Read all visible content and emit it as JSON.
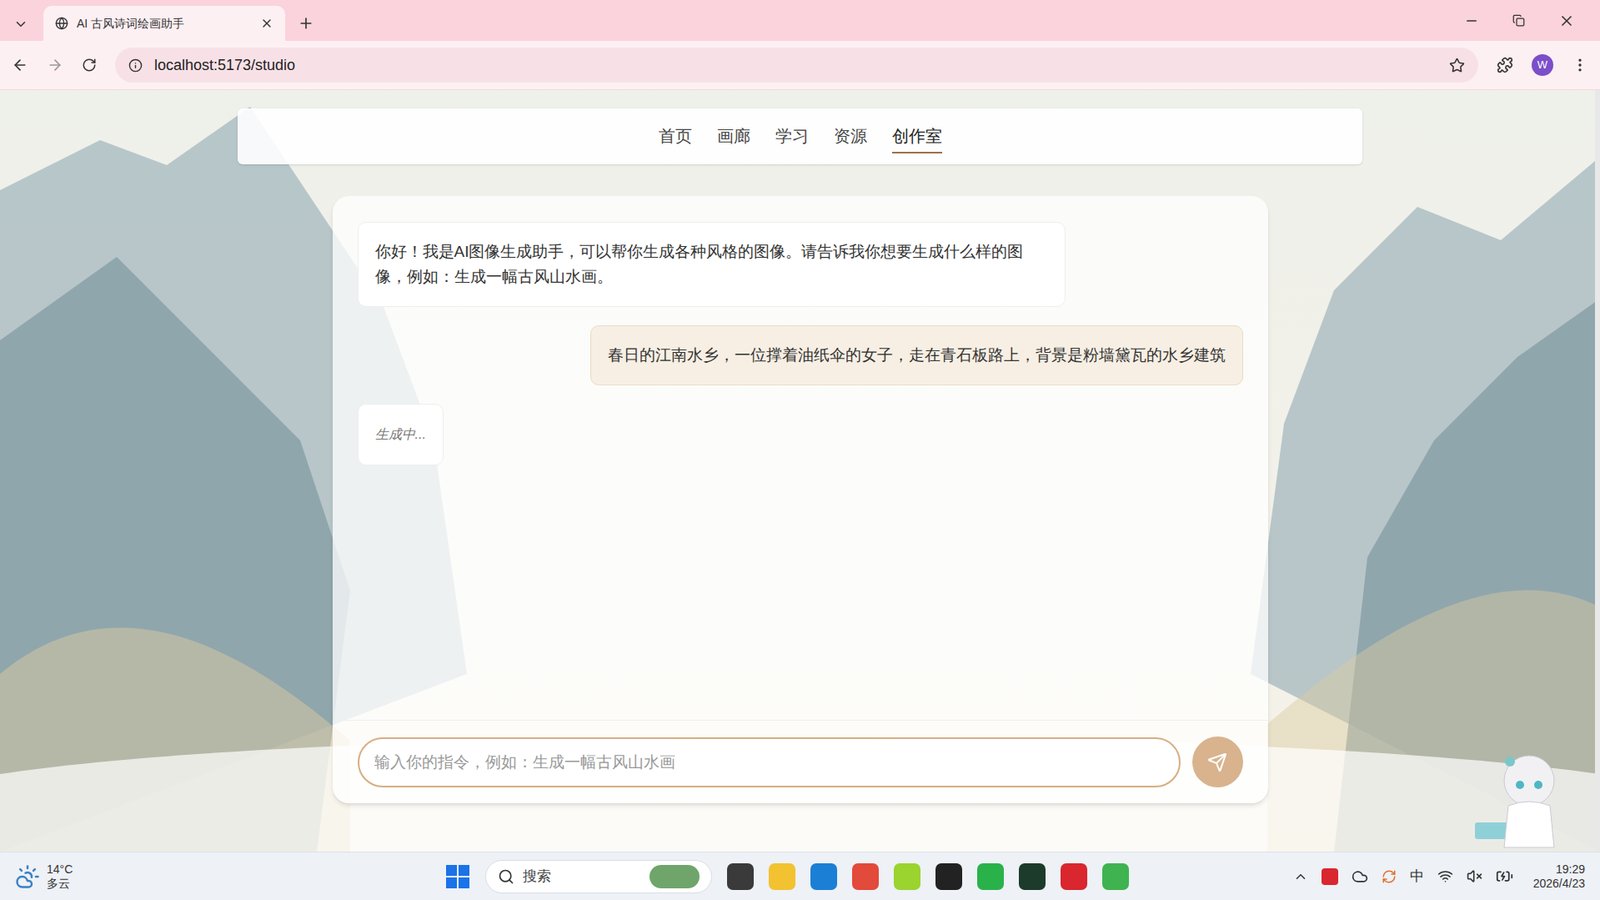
{
  "browser": {
    "tab_title": "AI 古风诗词绘画助手",
    "address": "localhost:5173/studio",
    "profile": "W"
  },
  "nav": [
    {
      "label": "首页",
      "selected": false
    },
    {
      "label": "画廊",
      "selected": false
    },
    {
      "label": "学习",
      "selected": false
    },
    {
      "label": "资源",
      "selected": false
    },
    {
      "label": "创作室",
      "selected": true
    }
  ],
  "messages": [
    {
      "role": "assistant",
      "kind": "text",
      "text": "你好！我是AI图像生成助手，可以帮你生成各种风格的图像。请告诉我你想要生成什么样的图像，例如：生成一幅古风山水画。"
    },
    {
      "role": "user",
      "kind": "text",
      "text": "春日的江南水乡，一位撑着油纸伞的女子，走在青石板路上，背景是粉墙黛瓦的水乡建筑"
    },
    {
      "role": "assistant",
      "kind": "pending",
      "text": "生成中..."
    }
  ],
  "input": {
    "placeholder": "输入你的指令，例如：生成一幅古风山水画"
  },
  "taskbar": {
    "weather": {
      "temp": "14°C",
      "condition": "多云"
    },
    "search": "搜索",
    "ime": "中",
    "time": "19:29",
    "date": "2026/4/23"
  }
}
